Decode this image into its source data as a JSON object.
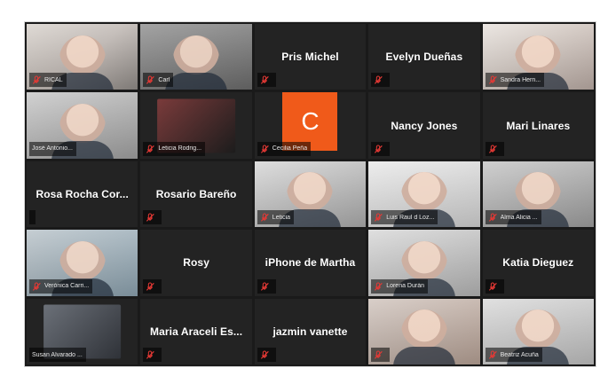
{
  "meeting": {
    "tiles": [
      {
        "type": "video",
        "label": "RICAL",
        "variant": "v1",
        "mic": true
      },
      {
        "type": "video",
        "label": "Carl",
        "variant": "v2",
        "mic": true
      },
      {
        "type": "name",
        "name": "Pris Michel",
        "mic": true
      },
      {
        "type": "name",
        "name": "Evelyn Dueñas",
        "mic": true
      },
      {
        "type": "video",
        "label": "Sandra Hern...",
        "variant": "v3",
        "mic": true
      },
      {
        "type": "video",
        "label": "José Antonio...",
        "variant": "v4",
        "mic": false
      },
      {
        "type": "inset",
        "label": "Leticia Rodrig...",
        "inset": "warm",
        "mic": true
      },
      {
        "type": "avatar",
        "letter": "C",
        "label": "Cecilia Peña",
        "mic": true
      },
      {
        "type": "name",
        "name": "Nancy Jones",
        "mic": true
      },
      {
        "type": "name",
        "name": "Mari Linares",
        "mic": true
      },
      {
        "type": "name",
        "name": "Rosa Rocha Cor...",
        "mic": false
      },
      {
        "type": "name",
        "name": "Rosario Bareño",
        "mic": true
      },
      {
        "type": "video",
        "label": "Leticia",
        "variant": "v6",
        "mic": true
      },
      {
        "type": "video",
        "label": "Luis Raul d Loz...",
        "variant": "v7",
        "mic": true
      },
      {
        "type": "video",
        "label": "Alma Alicia ...",
        "variant": "v8",
        "mic": true
      },
      {
        "type": "video",
        "label": "Verónica Carri...",
        "variant": "v9",
        "mic": true
      },
      {
        "type": "name",
        "name": "Rosy",
        "mic": true
      },
      {
        "type": "name",
        "name": "iPhone de Martha",
        "mic": true
      },
      {
        "type": "video",
        "label": "Lorena Durán",
        "variant": "v10",
        "mic": true
      },
      {
        "type": "name",
        "name": "Katia Dieguez",
        "mic": true
      },
      {
        "type": "inset",
        "label": "Susan Alvarado ...",
        "inset": "",
        "mic": false
      },
      {
        "type": "name",
        "name": "Maria Araceli Es...",
        "mic": true
      },
      {
        "type": "name",
        "name": "jazmin vanette",
        "mic": true
      },
      {
        "type": "video",
        "label": "",
        "variant": "v12",
        "mic": true
      },
      {
        "type": "video",
        "label": "Beatriz Acuña",
        "variant": "v13",
        "mic": true
      }
    ]
  },
  "colors": {
    "grid_bg": "#1a1a1a",
    "tile_bg": "#232323",
    "mic_muted_red": "#e53935",
    "avatar_orange": "#f05a1a"
  },
  "icons": {
    "mic": "microphone-muted-icon"
  }
}
